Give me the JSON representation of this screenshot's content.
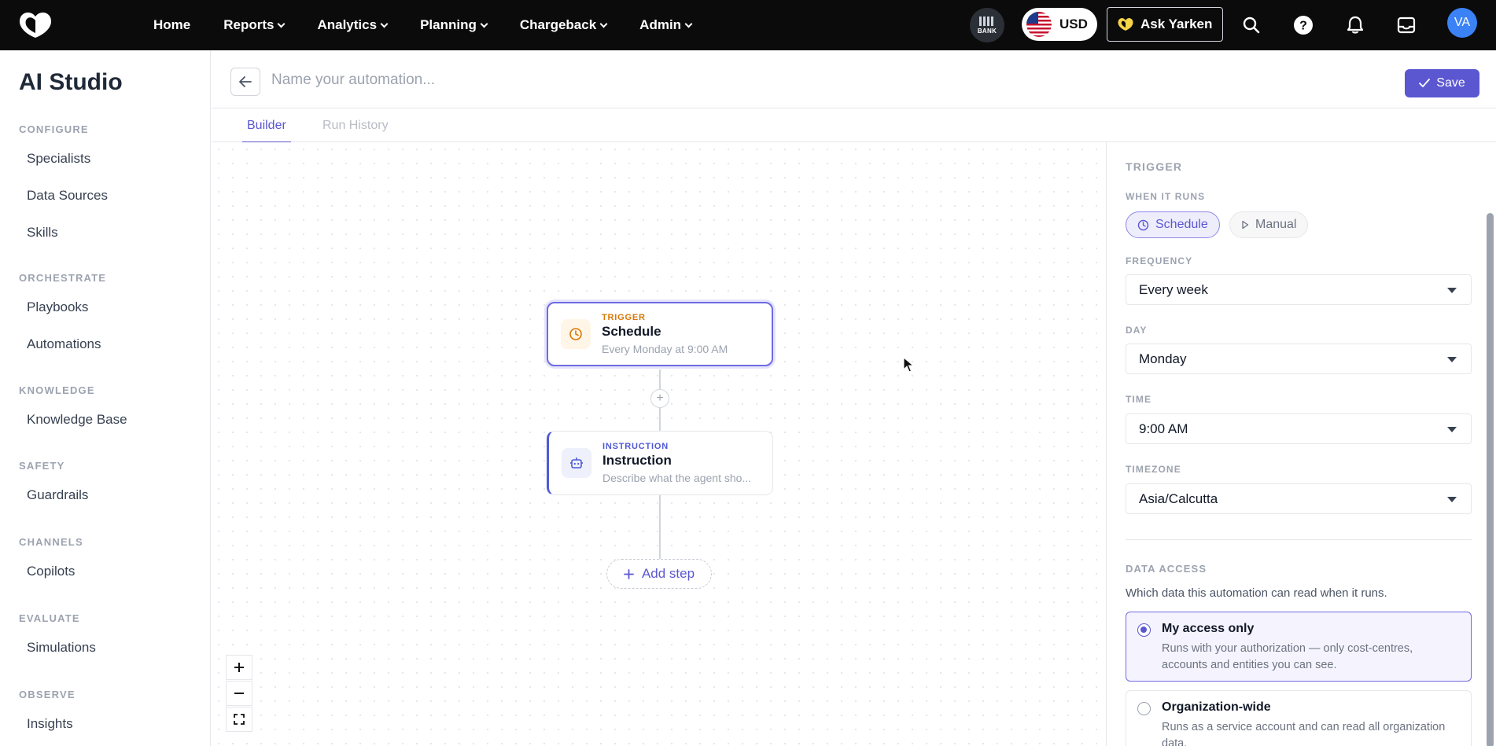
{
  "topbar": {
    "nav": [
      {
        "label": "Home",
        "has_dropdown": false
      },
      {
        "label": "Reports",
        "has_dropdown": true
      },
      {
        "label": "Analytics",
        "has_dropdown": true
      },
      {
        "label": "Planning",
        "has_dropdown": true
      },
      {
        "label": "Chargeback",
        "has_dropdown": true
      },
      {
        "label": "Admin",
        "has_dropdown": true
      }
    ],
    "bank_label": "BANK",
    "currency": "USD",
    "ask_label": "Ask Yarken",
    "avatar_initials": "VA",
    "icons": [
      "search-icon",
      "help-icon",
      "bell-icon",
      "inbox-icon"
    ]
  },
  "sidebar": {
    "title": "AI Studio",
    "sections": [
      {
        "title": "CONFIGURE",
        "items": [
          "Specialists",
          "Data Sources",
          "Skills"
        ]
      },
      {
        "title": "ORCHESTRATE",
        "items": [
          "Playbooks",
          "Automations"
        ]
      },
      {
        "title": "KNOWLEDGE",
        "items": [
          "Knowledge Base"
        ]
      },
      {
        "title": "SAFETY",
        "items": [
          "Guardrails"
        ]
      },
      {
        "title": "CHANNELS",
        "items": [
          "Copilots"
        ]
      },
      {
        "title": "EVALUATE",
        "items": [
          "Simulations"
        ]
      },
      {
        "title": "OBSERVE",
        "items": [
          "Insights"
        ]
      }
    ]
  },
  "header": {
    "name_placeholder": "Name your automation...",
    "name_value": "",
    "save_label": "Save"
  },
  "tabs": {
    "builder": "Builder",
    "run_history": "Run History",
    "active": "Builder"
  },
  "canvas": {
    "trigger_node": {
      "kind": "TRIGGER",
      "title": "Schedule",
      "subtitle": "Every Monday at 9:00 AM"
    },
    "instruction_node": {
      "kind": "INSTRUCTION",
      "title": "Instruction",
      "subtitle": "Describe what the agent sho..."
    },
    "add_step_label": "Add step",
    "zoom_controls": [
      "zoom-in-icon",
      "zoom-out-icon",
      "fit-view-icon"
    ]
  },
  "panel": {
    "title": "TRIGGER",
    "when_label": "WHEN IT RUNS",
    "when_options": {
      "schedule": "Schedule",
      "manual": "Manual",
      "selected": "Schedule"
    },
    "frequency": {
      "label": "FREQUENCY",
      "value": "Every week"
    },
    "day": {
      "label": "DAY",
      "value": "Monday"
    },
    "time": {
      "label": "TIME",
      "value": "9:00 AM"
    },
    "timezone": {
      "label": "TIMEZONE",
      "value": "Asia/Calcutta"
    },
    "data_access": {
      "label": "DATA ACCESS",
      "description": "Which data this automation can read when it runs.",
      "options": [
        {
          "title": "My access only",
          "description": "Runs with your authorization — only cost-centres, accounts and entities you can see.",
          "selected": true
        },
        {
          "title": "Organization-wide",
          "description": "Runs as a service account and can read all organization data.",
          "selected": false
        }
      ]
    }
  },
  "colors": {
    "accent": "#5b57d1",
    "trigger": "#d97706",
    "topbar": "#0b0b0c"
  }
}
